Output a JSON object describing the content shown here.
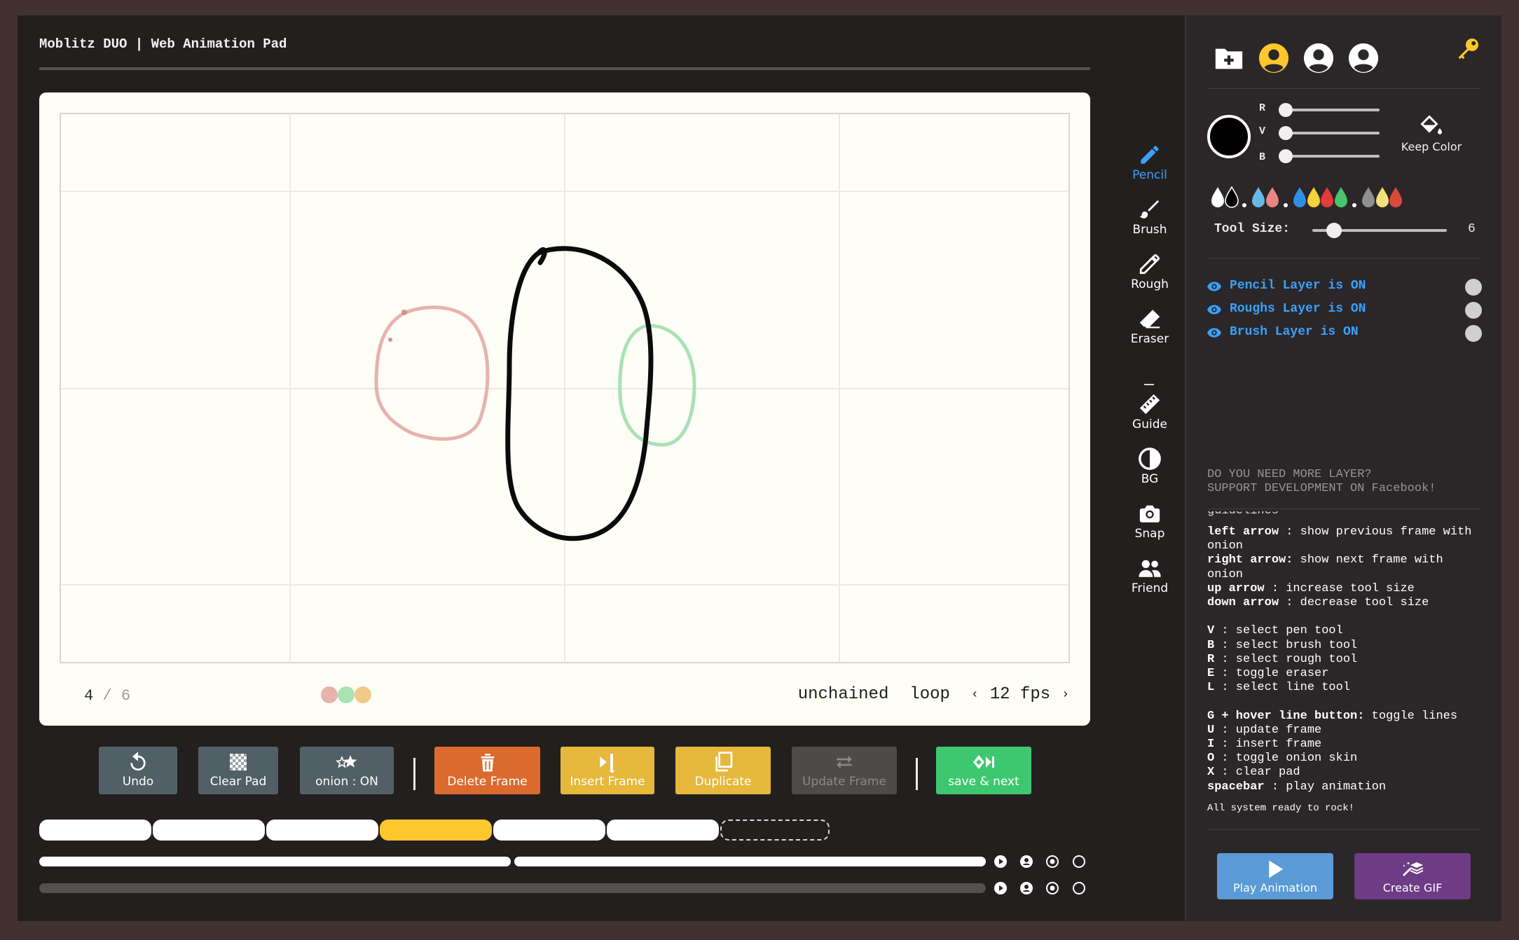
{
  "header": {
    "title": "Moblitz DUO | Web Animation Pad"
  },
  "pad": {
    "frame_current": "4",
    "frame_separator": "/",
    "frame_total": "6",
    "onion_colors": [
      "#e7b3ae",
      "#a9e2b3",
      "#f3c98a"
    ],
    "mode": "unchained",
    "playback": "loop",
    "fps_prev": "‹",
    "fps": "12 fps",
    "fps_next": "›"
  },
  "tools": [
    {
      "label": "Pencil",
      "icon": "pencil-icon",
      "active": true
    },
    {
      "label": "Brush",
      "icon": "brush-icon"
    },
    {
      "label": "Rough",
      "icon": "rough-pencil-icon"
    },
    {
      "label": "Eraser",
      "icon": "eraser-icon"
    },
    {
      "label": "Guide",
      "icon": "ruler-icon"
    },
    {
      "label": "BG",
      "icon": "contrast-icon"
    },
    {
      "label": "Snap",
      "icon": "camera-icon"
    },
    {
      "label": "Friend",
      "icon": "users-icon"
    }
  ],
  "side": {
    "rgb_labels": [
      "R",
      "V",
      "B"
    ],
    "rgb_values": [
      0,
      0,
      0
    ],
    "current_color": "#000000",
    "keep_color": "Keep Color",
    "palette": [
      "#ffffff",
      "#000000",
      "#66b8e8",
      "#e88585",
      "#2f8fe6",
      "#f5d33a",
      "#e33b3b",
      "#46c46e",
      "#8f8f8f",
      "#f3e07c",
      "#d94a3a"
    ],
    "tool_size_label": "Tool Size:",
    "tool_size": "6",
    "layers": [
      {
        "label": "Pencil Layer is ON"
      },
      {
        "label": "Roughs Layer is ON"
      },
      {
        "label": "Brush Layer is ON"
      }
    ],
    "support_line1": "DO YOU NEED MORE LAYER?",
    "support_line2": "SUPPORT DEVELOPMENT ON Facebook!",
    "help_partial": "guidelines",
    "help_lines": [
      {
        "key": "left arrow",
        "desc": " : show previous frame with"
      },
      {
        "key": "",
        "desc": "onion"
      },
      {
        "key": "right arrow:",
        "desc": " show next frame with"
      },
      {
        "key": "",
        "desc": "onion"
      },
      {
        "key": "up arrow",
        "desc": " : increase tool size"
      },
      {
        "key": "down arrow",
        "desc": " : decrease tool size"
      },
      {
        "key": "",
        "desc": ""
      },
      {
        "key": "V",
        "desc": " : select pen tool"
      },
      {
        "key": "B",
        "desc": " : select brush tool"
      },
      {
        "key": "R",
        "desc": " : select rough tool"
      },
      {
        "key": "E",
        "desc": " : toggle eraser"
      },
      {
        "key": "L",
        "desc": " : select line tool"
      },
      {
        "key": "",
        "desc": ""
      },
      {
        "key": "G + hover line button:",
        "desc": " toggle lines"
      },
      {
        "key": "U",
        "desc": " : update frame"
      },
      {
        "key": "I",
        "desc": " : insert frame"
      },
      {
        "key": "O",
        "desc": " : toggle onion skin"
      },
      {
        "key": "X",
        "desc": " : clear pad"
      },
      {
        "key": "spacebar",
        "desc": " : play animation"
      }
    ],
    "status": "All system ready to rock!",
    "play_label": "Play Animation",
    "gif_label": "Create GIF"
  },
  "actions": {
    "undo": "Undo",
    "clear_pad": "Clear Pad",
    "onion": "onion : ON",
    "delete_frame": "Delete Frame",
    "insert_frame": "Insert Frame",
    "duplicate": "Duplicate",
    "update_frame": "Update Frame",
    "save_next": "save & next"
  },
  "colors": {
    "accent_blue": "#3aa1ff",
    "timeline_current": "#fec72e",
    "delete": "#dc6a2f",
    "insert": "#e6b83c",
    "save": "#3dc86f",
    "play": "#5a9ad6",
    "gif": "#6e3b85"
  },
  "timeline": {
    "frame_count": 6,
    "current_index": 3
  }
}
